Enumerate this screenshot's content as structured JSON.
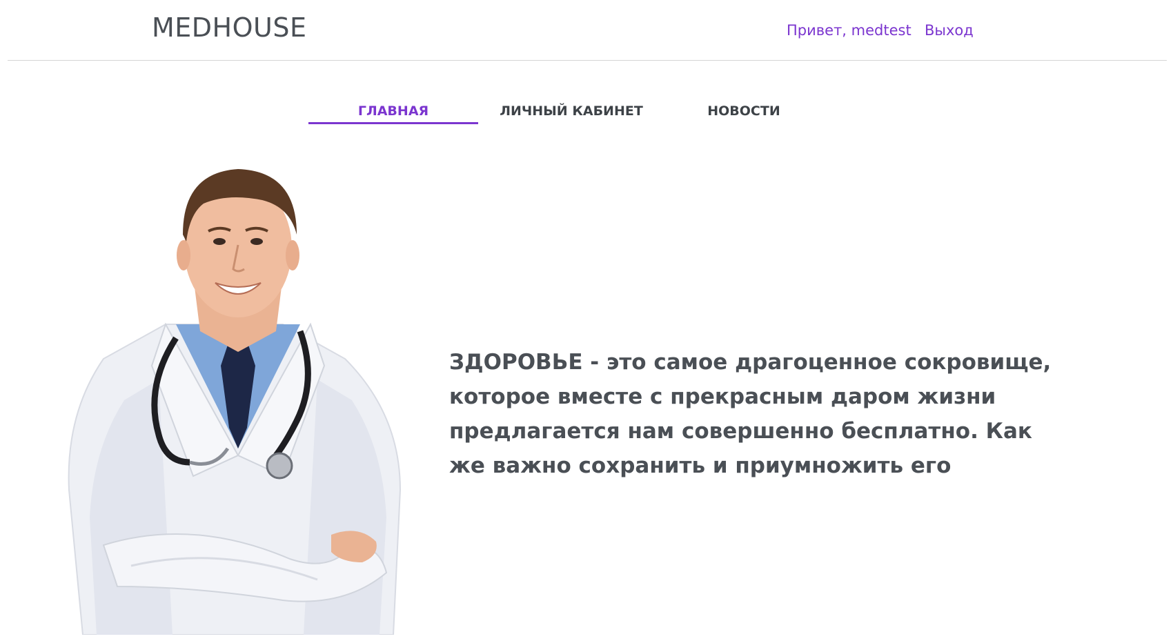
{
  "header": {
    "logo": "MEDHOUSE",
    "greeting": "Привет, medtest",
    "logout": "Выход",
    "accent_color": "#7b35cf"
  },
  "nav": {
    "tabs": [
      {
        "label": "ГЛАВНАЯ",
        "active": true
      },
      {
        "label": "ЛИЧНЫЙ КАБИНЕТ",
        "active": false
      },
      {
        "label": "НОВОСТИ",
        "active": false
      }
    ]
  },
  "hero": {
    "image": "doctor-photo",
    "quote": "ЗДОРОВЬЕ - это самое драгоценное сокровище, которое вместе с прекрасным даром жизни предлагается нам совершенно бесплатно. Как же важно сохранить и приумножить его"
  }
}
